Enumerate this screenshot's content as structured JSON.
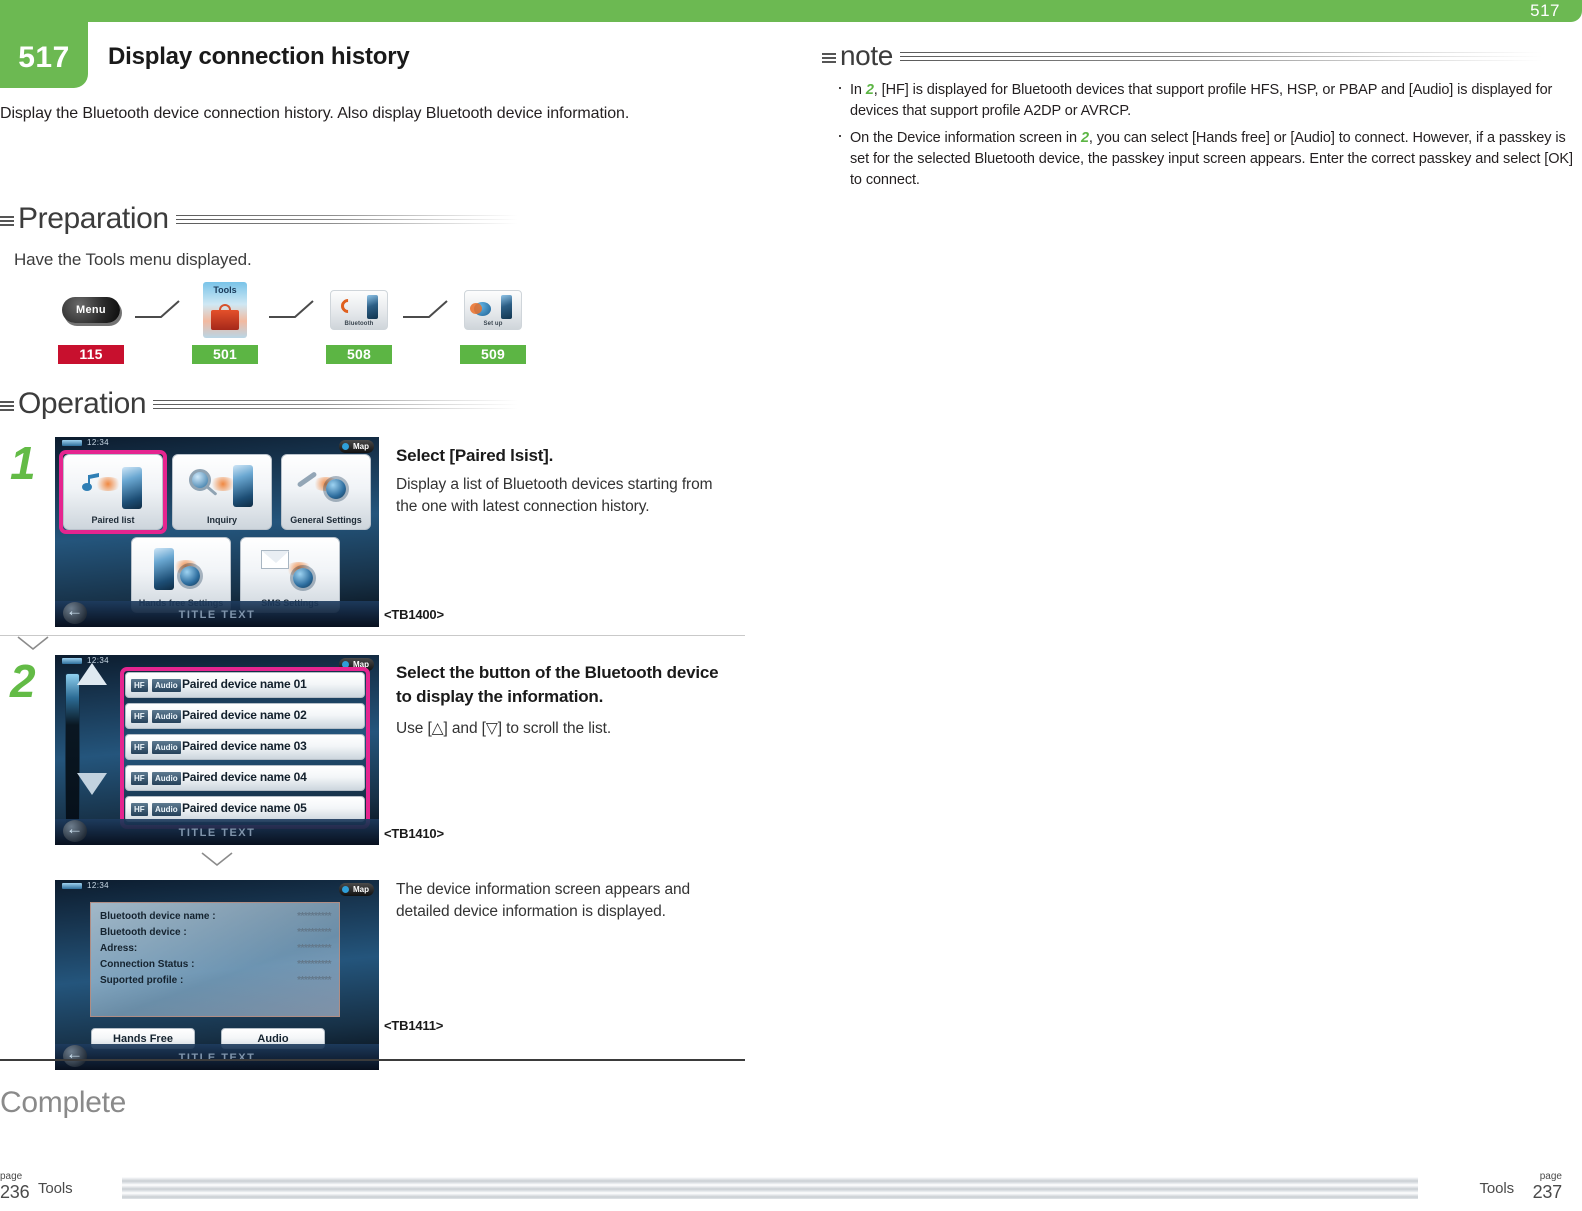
{
  "header": {
    "top_page_number": "517",
    "section_number": "517",
    "title": "Display connection history",
    "lead": "Display the Bluetooth device connection history. Also display Bluetooth device information."
  },
  "preparation": {
    "heading": "Preparation",
    "text": "Have the Tools menu displayed.",
    "flow": [
      {
        "icon": "menu-button-icon",
        "caption": "Menu",
        "ref": "115",
        "ref_color": "#c8102e"
      },
      {
        "icon": "tools-icon",
        "caption": "Tools",
        "ref": "501",
        "ref_color": "#5cb544"
      },
      {
        "icon": "bluetooth-icon",
        "caption": "Bluetooth",
        "ref": "508",
        "ref_color": "#5cb544"
      },
      {
        "icon": "setup-icon",
        "caption": "Set up",
        "ref": "509",
        "ref_color": "#5cb544"
      }
    ]
  },
  "operation": {
    "heading": "Operation",
    "steps": [
      {
        "number": "1",
        "title": "Select [Paired lsist].",
        "body": "Display a list of Bluetooth devices starting from the one with latest connection history.",
        "shot_id": "<TB1400>",
        "screen": {
          "time": "12:34",
          "map_button": "Map",
          "title_text": "TITLE TEXT",
          "tiles": [
            {
              "label": "Paired list",
              "highlighted": true
            },
            {
              "label": "Inquiry",
              "highlighted": false
            },
            {
              "label": "General Settings",
              "highlighted": false
            },
            {
              "label": "Hands free Settings",
              "highlighted": false
            },
            {
              "label": "SMS Settings",
              "highlighted": false
            }
          ]
        }
      },
      {
        "number": "2",
        "title": "Select the button of the Bluetooth device to display the information.",
        "body": "Use [△] and [▽] to scroll the list.",
        "shot_id": "<TB1410>",
        "screen": {
          "time": "12:34",
          "map_button": "Map",
          "title_text": "TITLE TEXT",
          "chip_hf": "HF",
          "chip_audio": "Audio",
          "rows": [
            "Paired device name 01",
            "Paired device name 02",
            "Paired device name 03",
            "Paired device name 04",
            "Paired device name 05"
          ]
        }
      }
    ],
    "result": {
      "body": "The device information screen appears and detailed device information is displayed.",
      "shot_id": "<TB1411>",
      "screen": {
        "time": "12:34",
        "map_button": "Map",
        "title_text": "TITLE TEXT",
        "info_rows": [
          {
            "label": "Bluetooth device name :",
            "value": "**********"
          },
          {
            "label": "Bluetooth device :",
            "value": "**********"
          },
          {
            "label": "Adress:",
            "value": "**********"
          },
          {
            "label": "Connection Status :",
            "value": "**********"
          },
          {
            "label": "Suported profile :",
            "value": "**********"
          }
        ],
        "buttons": [
          "Hands Free",
          "Audio"
        ]
      }
    },
    "complete": "Complete"
  },
  "note": {
    "heading": "note",
    "items": [
      {
        "pre": "In ",
        "ref": "2",
        "post": ", [HF] is displayed for Bluetooth devices that support profile HFS, HSP, or PBAP and [Audio] is displayed for devices that support profile A2DP or AVRCP."
      },
      {
        "pre": "On the Device information screen in ",
        "ref": "2",
        "post": ", you can select [Hands free] or [Audio] to connect. However, if a passkey is set for the selected Bluetooth device, the passkey input screen appears. Enter the correct passkey and select [OK] to connect."
      }
    ]
  },
  "footer": {
    "left_page_label": "page",
    "left_page_number": "236",
    "left_chapter": "Tools",
    "right_chapter": "Tools",
    "right_page_label": "page",
    "right_page_number": "237"
  }
}
